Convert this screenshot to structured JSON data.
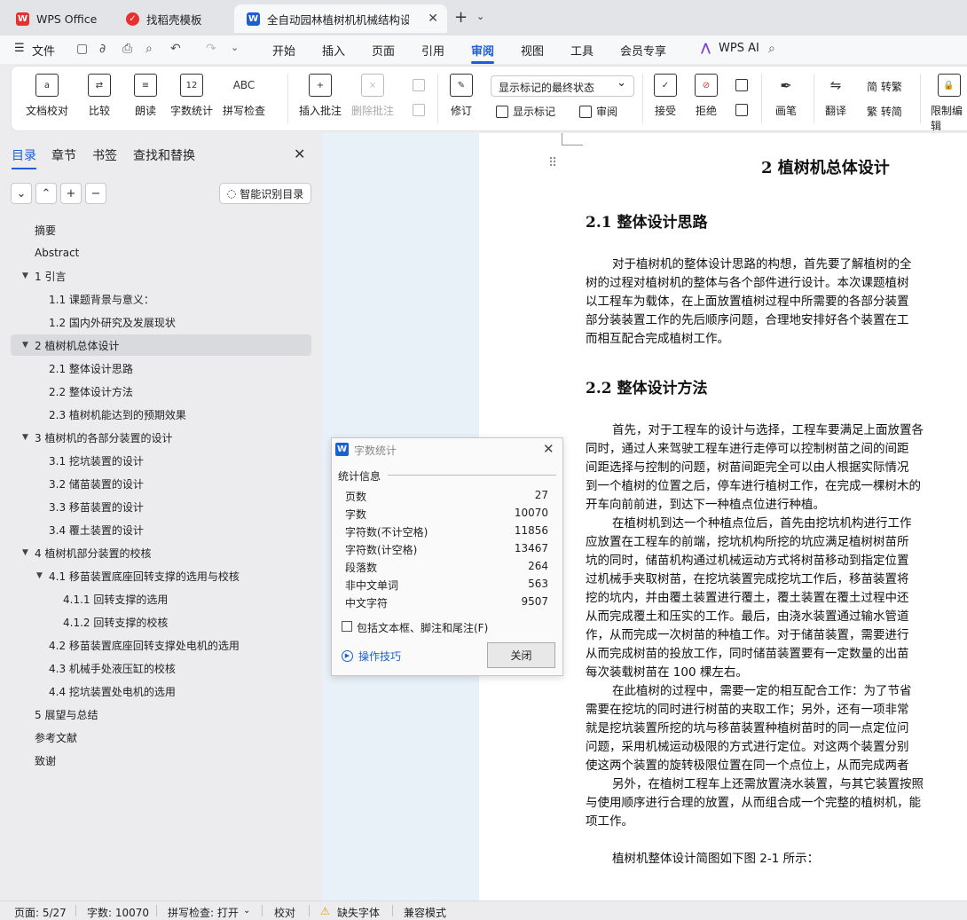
{
  "tabs": [
    {
      "label": "WPS Office"
    },
    {
      "label": "找稻壳模板"
    },
    {
      "label": "全自动园林植树机机械结构设计"
    }
  ],
  "menu": {
    "file": "文件",
    "items": [
      "开始",
      "插入",
      "页面",
      "引用",
      "审阅",
      "视图",
      "工具",
      "会员专享"
    ],
    "active": "审阅",
    "wpsai": "WPS AI"
  },
  "ribbon": {
    "doc_check": "文档校对",
    "compare": "比较",
    "read": "朗读",
    "word_count": "字数统计",
    "spell_check": "拼写检查",
    "insert_comment": "插入批注",
    "delete_comment": "删除批注",
    "revise": "修订",
    "show_markup_select": "显示标记的最终状态",
    "show_markup": "显示标记",
    "review": "审阅",
    "accept": "接受",
    "reject": "拒绝",
    "pen": "画笔",
    "translate": "翻译",
    "to_traditional": "简 转繁",
    "to_simplified": "繁 转简",
    "restrict_edit": "限制编辑"
  },
  "nav": {
    "tabs": [
      "目录",
      "章节",
      "书签",
      "查找和替换"
    ],
    "smart_toc": "智能识别目录",
    "toc": [
      "摘要",
      "Abstract",
      "1  引言",
      "1.1  课题背景与意义：",
      "1.2  国内外研究及发展现状",
      "2  植树机总体设计",
      "2.1    整体设计思路",
      "2.2  整体设计方法",
      "2.3 植树机能达到的预期效果",
      "3    植树机的各部分装置的设计",
      "3.1  挖坑装置的设计",
      "3.2  储苗装置的设计",
      "3.3    移苗装置的设计",
      "3.4    覆土装置的设计",
      "4    植树机部分装置的校核",
      "4.1  移苗装置底座回转支撑的选用与校核",
      "4.1.1  回转支撑的选用",
      "4.1.2 回转支撑的校核",
      "4.2 移苗装置底座回转支撑处电机的选用",
      "4.3   机械手处液压缸的校核",
      "4.4 挖坑装置处电机的选用",
      "5    展望与总结",
      "参考文献",
      "致谢"
    ]
  },
  "document": {
    "chapter_title": "2  植树机总体设计",
    "s21_title": "2.1   整体设计思路",
    "p1": [
      "对于植树机的整体设计思路的构想，首先要了解植树的全",
      "树的过程对植树机的整体与各个部件进行设计。本次课题植树",
      "以工程车为载体，在上面放置植树过程中所需要的各部分装置",
      "部分装装置工作的先后顺序问题，合理地安排好各个装置在工",
      "而相互配合完成植树工作。"
    ],
    "s22_title": "2.2  整体设计方法",
    "p2": [
      "首先，对于工程车的设计与选择，工程车要满足上面放置各",
      "同时，通过人来驾驶工程车进行走停可以控制树苗之间的间距",
      "间距选择与控制的问题，树苗间距完全可以由人根据实际情况",
      "到一个植树的位置之后，停车进行植树工作，在完成一棵树木的",
      "开车向前前进，到达下一种植点位进行种植。",
      "在植树机到达一个种植点位后，首先由挖坑机构进行工作",
      "应放置在工程车的前端，挖坑机构所挖的坑应满足植树树苗所",
      "坑的同时，储苗机构通过机械运动方式将树苗移动到指定位置",
      "过机械手夹取树苗，在挖坑装置完成挖坑工作后，移苗装置将",
      "挖的坑内，并由覆土装置进行覆土，覆土装置在覆土过程中还",
      "从而完成覆土和压实的工作。最后，由浇水装置通过输水管道",
      "作，从而完成一次树苗的种植工作。对于储苗装置，需要进行",
      "从而完成树苗的投放工作，同时储苗装置要有一定数量的出苗",
      "每次装载树苗在 100 棵左右。",
      "在此植树的过程中，需要一定的相互配合工作：为了节省",
      "需要在挖坑的同时进行树苗的夹取工作；另外，还有一项非常",
      "就是挖坑装置所挖的坑与移苗装置种植树苗时的同一点定位问",
      "问题，采用机械运动极限的方式进行定位。对这两个装置分别",
      "使这两个装置的旋转极限位置在同一个点位上，从而完成两者",
      "另外，在植树工程车上还需放置浇水装置，与其它装置按照",
      "与使用顺序进行合理的放置，从而组合成一个完整的植树机，能",
      "项工作。"
    ],
    "figure_line": "植树机整体设计简图如下图 2-1 所示："
  },
  "dialog": {
    "title": "字数统计",
    "section": "统计信息",
    "rows": [
      {
        "label": "页数",
        "value": "27"
      },
      {
        "label": "字数",
        "value": "10070"
      },
      {
        "label": "字符数(不计空格)",
        "value": "11856"
      },
      {
        "label": "字符数(计空格)",
        "value": "13467"
      },
      {
        "label": "段落数",
        "value": "264"
      },
      {
        "label": "非中文单词",
        "value": "563"
      },
      {
        "label": "中文字符",
        "value": "9507"
      }
    ],
    "checkbox": "包括文本框、脚注和尾注(F)",
    "tips": "操作技巧",
    "close": "关闭"
  },
  "status": {
    "page": "页面: 5/27",
    "words": "字数: 10070",
    "spell": "拼写检查: 打开",
    "proof": "校对",
    "missing_font": "缺失字体",
    "compat": "兼容模式"
  },
  "colors": {
    "accent": "#1b5fd6",
    "wps_red": "#e8312f"
  }
}
